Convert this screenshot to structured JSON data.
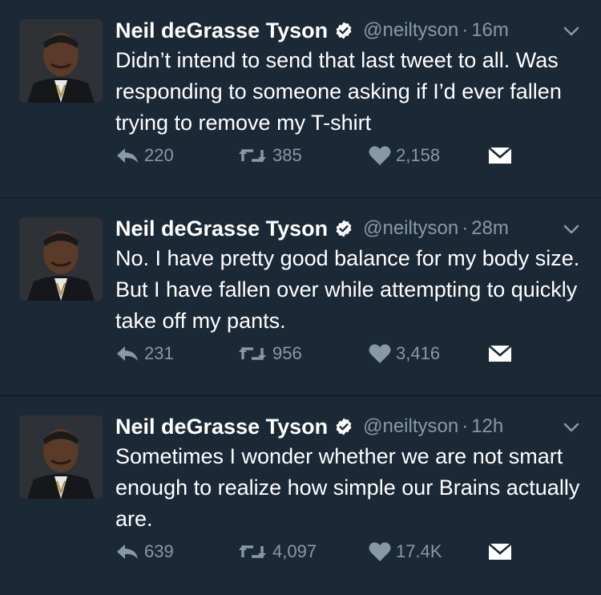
{
  "colors": {
    "background": "#1b2836",
    "text": "#ffffff",
    "secondary": "#8899a6",
    "verified_badge": "#ffffff"
  },
  "tweets": [
    {
      "name": "Neil deGrasse Tyson",
      "handle": "@neiltyson",
      "separator": "·",
      "time": "16m",
      "text": "Didn’t intend to send that last tweet to all. Was responding to someone asking if I’d ever fallen trying to remove my T-shirt",
      "replies": "220",
      "retweets": "385",
      "likes": "2,158",
      "icons": [
        "reply-icon",
        "retweet-icon",
        "heart-icon",
        "envelope-icon",
        "chevron-down-icon",
        "verified-badge-icon"
      ]
    },
    {
      "name": "Neil deGrasse Tyson",
      "handle": "@neiltyson",
      "separator": "·",
      "time": "28m",
      "text": "No. I have pretty good balance for my body size.  But I have fallen over while attempting to quickly take off my pants.",
      "replies": "231",
      "retweets": "956",
      "likes": "3,416",
      "icons": [
        "reply-icon",
        "retweet-icon",
        "heart-icon",
        "envelope-icon",
        "chevron-down-icon",
        "verified-badge-icon"
      ]
    },
    {
      "name": "Neil deGrasse Tyson",
      "handle": "@neiltyson",
      "separator": "·",
      "time": "12h",
      "text": "Sometimes I wonder whether we are not smart enough to realize how simple our Brains actually are.",
      "replies": "639",
      "retweets": "4,097",
      "likes": "17.4K",
      "icons": [
        "reply-icon",
        "retweet-icon",
        "heart-icon",
        "envelope-icon",
        "chevron-down-icon",
        "verified-badge-icon"
      ]
    }
  ]
}
